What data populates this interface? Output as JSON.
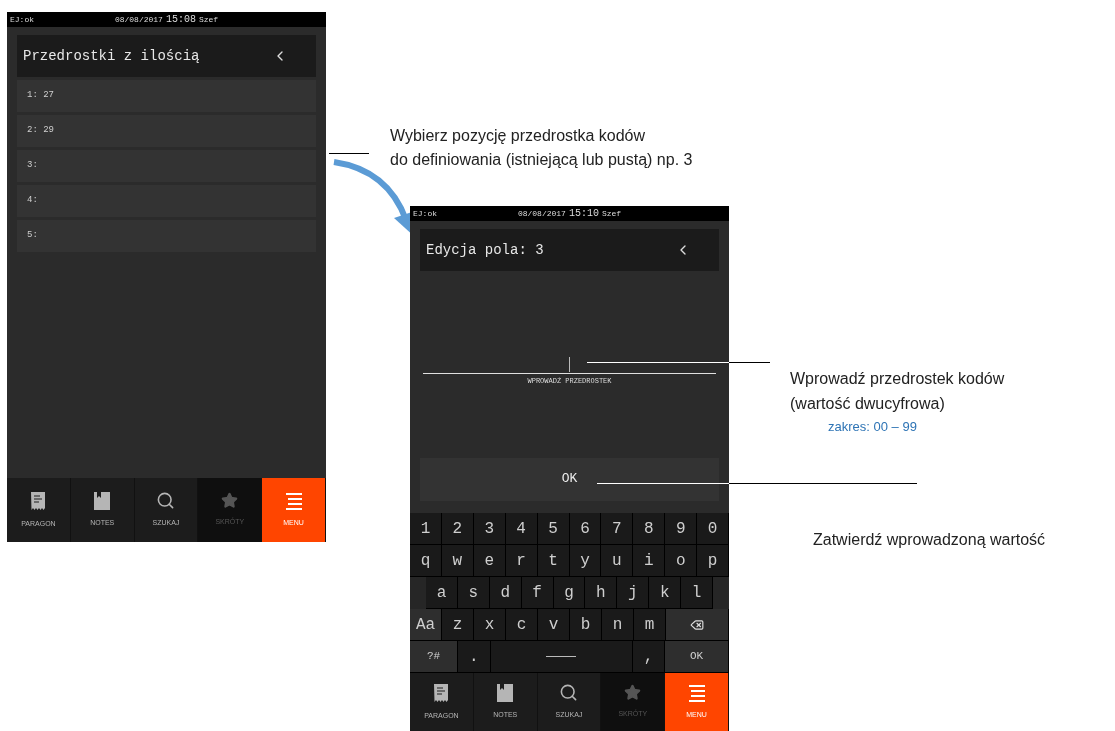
{
  "screen_list": {
    "status": {
      "left": "EJ:ok",
      "date": "08/08/2017",
      "time": "15:08",
      "user": "Szef"
    },
    "title": "Przedrostki z ilością",
    "items": [
      {
        "label": "1: 27"
      },
      {
        "label": "2: 29"
      },
      {
        "label": "3:"
      },
      {
        "label": "4:"
      },
      {
        "label": "5:"
      }
    ],
    "nav": [
      {
        "kind": "receipt",
        "label": "PARAGON",
        "selected": false,
        "disabled": false
      },
      {
        "kind": "notes",
        "label": "NOTES",
        "selected": false,
        "disabled": false
      },
      {
        "kind": "search",
        "label": "SZUKAJ",
        "selected": false,
        "disabled": false
      },
      {
        "kind": "star",
        "label": "SKRÓTY",
        "selected": false,
        "disabled": true
      },
      {
        "kind": "menu",
        "label": "MENU",
        "selected": true,
        "disabled": false
      }
    ]
  },
  "annotation_select": [
    "Wybierz pozycję przedrostka kodów",
    "do definiowania (istniejącą lub pustą) np. 3"
  ],
  "screen_edit": {
    "status": {
      "left": "EJ:ok",
      "date": "08/08/2017",
      "time": "15:10",
      "user": "Szef"
    },
    "title": "Edycja pola: 3",
    "field_label": "WPROWADŹ PRZEDROSTEK",
    "ok_button": "OK",
    "keyboard": [
      [
        {
          "kind": "key",
          "label": "1"
        },
        {
          "kind": "key",
          "label": "2"
        },
        {
          "kind": "key",
          "label": "3"
        },
        {
          "kind": "key",
          "label": "4"
        },
        {
          "kind": "key",
          "label": "5"
        },
        {
          "kind": "key",
          "label": "6"
        },
        {
          "kind": "key",
          "label": "7"
        },
        {
          "kind": "key",
          "label": "8"
        },
        {
          "kind": "key",
          "label": "9"
        },
        {
          "kind": "key",
          "label": "0"
        }
      ],
      [
        {
          "kind": "key",
          "label": "q"
        },
        {
          "kind": "key",
          "label": "w"
        },
        {
          "kind": "key",
          "label": "e"
        },
        {
          "kind": "key",
          "label": "r"
        },
        {
          "kind": "key",
          "label": "t"
        },
        {
          "kind": "key",
          "label": "y"
        },
        {
          "kind": "key",
          "label": "u"
        },
        {
          "kind": "key",
          "label": "i"
        },
        {
          "kind": "key",
          "label": "o"
        },
        {
          "kind": "key",
          "label": "p"
        }
      ],
      [
        {
          "kind": "key",
          "label": "a"
        },
        {
          "kind": "key",
          "label": "s"
        },
        {
          "kind": "key",
          "label": "d"
        },
        {
          "kind": "key",
          "label": "f"
        },
        {
          "kind": "key",
          "label": "g"
        },
        {
          "kind": "key",
          "label": "h"
        },
        {
          "kind": "key",
          "label": "j"
        },
        {
          "kind": "key",
          "label": "k"
        },
        {
          "kind": "key",
          "label": "l"
        }
      ],
      [
        {
          "kind": "shift",
          "label": "Aa"
        },
        {
          "kind": "key",
          "label": "z"
        },
        {
          "kind": "key",
          "label": "x"
        },
        {
          "kind": "key",
          "label": "c"
        },
        {
          "kind": "key",
          "label": "v"
        },
        {
          "kind": "key",
          "label": "b"
        },
        {
          "kind": "key",
          "label": "n"
        },
        {
          "kind": "key",
          "label": "m"
        },
        {
          "kind": "backspace"
        }
      ],
      [
        {
          "kind": "mode",
          "label": "?#"
        },
        {
          "kind": "key",
          "label": "."
        },
        {
          "kind": "space"
        },
        {
          "kind": "key",
          "label": ","
        },
        {
          "kind": "action",
          "label": "OK"
        }
      ]
    ],
    "nav": [
      {
        "kind": "receipt",
        "label": "PARAGON",
        "selected": false,
        "disabled": false
      },
      {
        "kind": "notes",
        "label": "NOTES",
        "selected": false,
        "disabled": false
      },
      {
        "kind": "search",
        "label": "SZUKAJ",
        "selected": false,
        "disabled": false
      },
      {
        "kind": "star",
        "label": "SKRÓTY",
        "selected": false,
        "disabled": true
      },
      {
        "kind": "menu",
        "label": "MENU",
        "selected": true,
        "disabled": false
      }
    ]
  },
  "annotation_input": [
    "Wprowadź przedrostek kodów",
    "(wartość dwucyfrowa)"
  ],
  "annotation_range": "zakres: 00 – 99",
  "annotation_ok": "Zatwierdź wprowadzoną wartość"
}
